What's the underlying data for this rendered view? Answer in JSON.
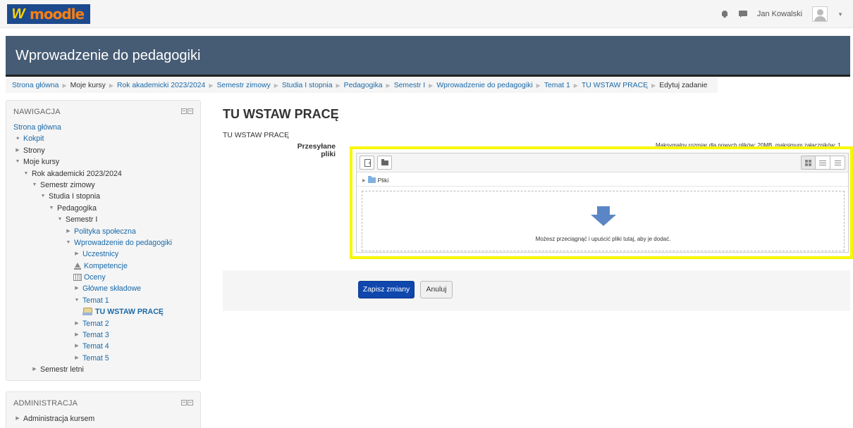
{
  "topbar": {
    "logo_prefix": "W",
    "logo_text": "moodle",
    "user_name": "Jan Kowalski",
    "icons": [
      "bell-icon",
      "chat-icon",
      "avatar",
      "caret-down-icon"
    ]
  },
  "header": {
    "course_title": "Wprowadzenie do pedagogiki"
  },
  "breadcrumb": [
    "Strona główna",
    "Moje kursy",
    "Rok akademicki 2023/2024",
    "Semestr zimowy",
    "Studia I stopnia",
    "Pedagogika",
    "Semestr I",
    "Wprowadzenie do pedagogiki",
    "Temat 1",
    "TU WSTAW PRACĘ",
    "Edytuj zadanie"
  ],
  "navigation": {
    "title": "NAWIGACJA",
    "items": [
      "Strona główna",
      "Kokpit",
      "Strony",
      "Moje kursy",
      "Rok akademicki 2023/2024",
      "Semestr zimowy",
      "Studia I stopnia",
      "Pedagogika",
      "Semestr I",
      "Polityka społeczna",
      "Wprowadzenie do pedagogiki",
      "Uczestnicy",
      "Kompetencje",
      "Oceny",
      "Główne składowe",
      "Temat 1",
      "TU WSTAW PRACĘ",
      "Temat 2",
      "Temat 3",
      "Temat 4",
      "Temat 5",
      "Semestr letni"
    ]
  },
  "administration": {
    "title": "ADMINISTRACJA",
    "items": [
      "Administracja kursem"
    ]
  },
  "main": {
    "title": "TU WSTAW PRACĘ",
    "subtitle": "TU WSTAW PRACĘ",
    "field_label": "Przesyłane pliki",
    "max_size_text": "Maksymalny rozmiar dla nowych plików: 20MB, maksimum załączników: 1",
    "folder_label": "Pliki",
    "drop_text": "Możesz przeciągnąć i upuścić pliki tutaj, aby je dodać.",
    "highlight_color": "#f7f700"
  },
  "actions": {
    "save_label": "Zapisz zmiany",
    "cancel_label": "Anuluj",
    "save_color": "#0f47ad"
  }
}
